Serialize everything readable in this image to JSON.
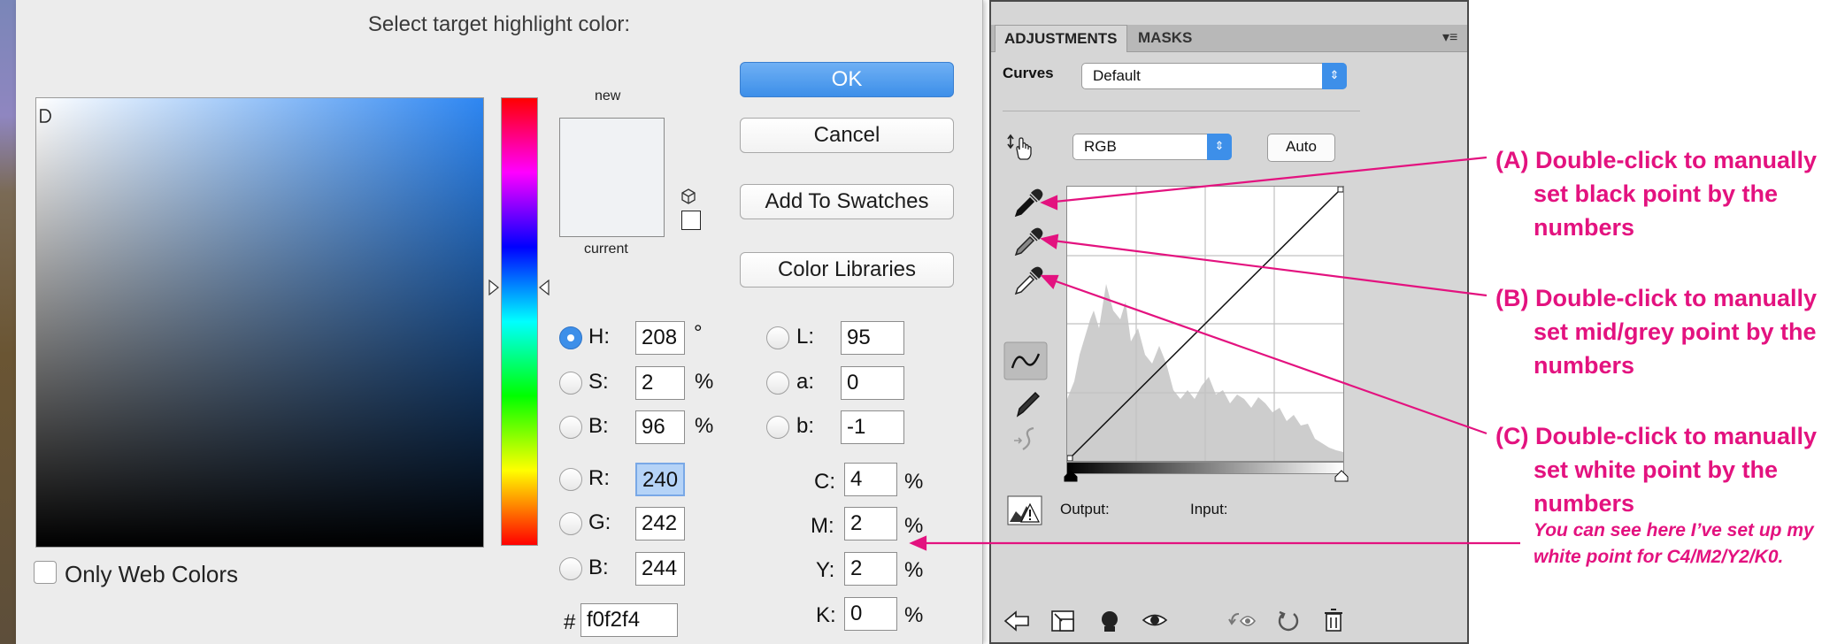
{
  "dialog": {
    "title": "Select target highlight color:",
    "new_label": "new",
    "current_label": "current",
    "swatch_color": "#f0f2f4",
    "buttons": {
      "ok": "OK",
      "cancel": "Cancel",
      "add_to_swatches": "Add To Swatches",
      "color_libraries": "Color Libraries"
    },
    "hsb": {
      "h": {
        "label": "H:",
        "value": "208",
        "unit": "°",
        "selected": true
      },
      "s": {
        "label": "S:",
        "value": "2",
        "unit": "%"
      },
      "b": {
        "label": "B:",
        "value": "96",
        "unit": "%"
      }
    },
    "rgb": {
      "r": {
        "label": "R:",
        "value": "240"
      },
      "g": {
        "label": "G:",
        "value": "242"
      },
      "b": {
        "label": "B:",
        "value": "244"
      }
    },
    "lab": {
      "l": {
        "label": "L:",
        "value": "95"
      },
      "a": {
        "label": "a:",
        "value": "0"
      },
      "b": {
        "label": "b:",
        "value": "-1"
      }
    },
    "cmyk": {
      "c": {
        "label": "C:",
        "value": "4",
        "unit": "%"
      },
      "m": {
        "label": "M:",
        "value": "2",
        "unit": "%"
      },
      "y": {
        "label": "Y:",
        "value": "2",
        "unit": "%"
      },
      "k": {
        "label": "K:",
        "value": "0",
        "unit": "%"
      }
    },
    "hex": {
      "label": "#",
      "value": "f0f2f4"
    },
    "only_web_colors": {
      "label": "Only Web Colors",
      "checked": false
    }
  },
  "panel": {
    "tabs": [
      "ADJUSTMENTS",
      "MASKS"
    ],
    "active_tab": "ADJUSTMENTS",
    "adjustment_label": "Curves",
    "preset": "Default",
    "channel": "RGB",
    "auto_label": "Auto",
    "output_label": "Output:",
    "input_label": "Input:"
  },
  "annotations": {
    "a": [
      "(A) Double-click to manually",
      "set black point by the",
      "numbers"
    ],
    "b": [
      "(B) Double-click to manually",
      "set mid/grey point by the",
      "numbers"
    ],
    "c": [
      "(C) Double-click to manually",
      "set white point by the",
      "numbers"
    ],
    "note": [
      "You can see here I’ve set up my",
      "white point for C4/M2/Y2/K0."
    ],
    "color": "#e3127f"
  }
}
